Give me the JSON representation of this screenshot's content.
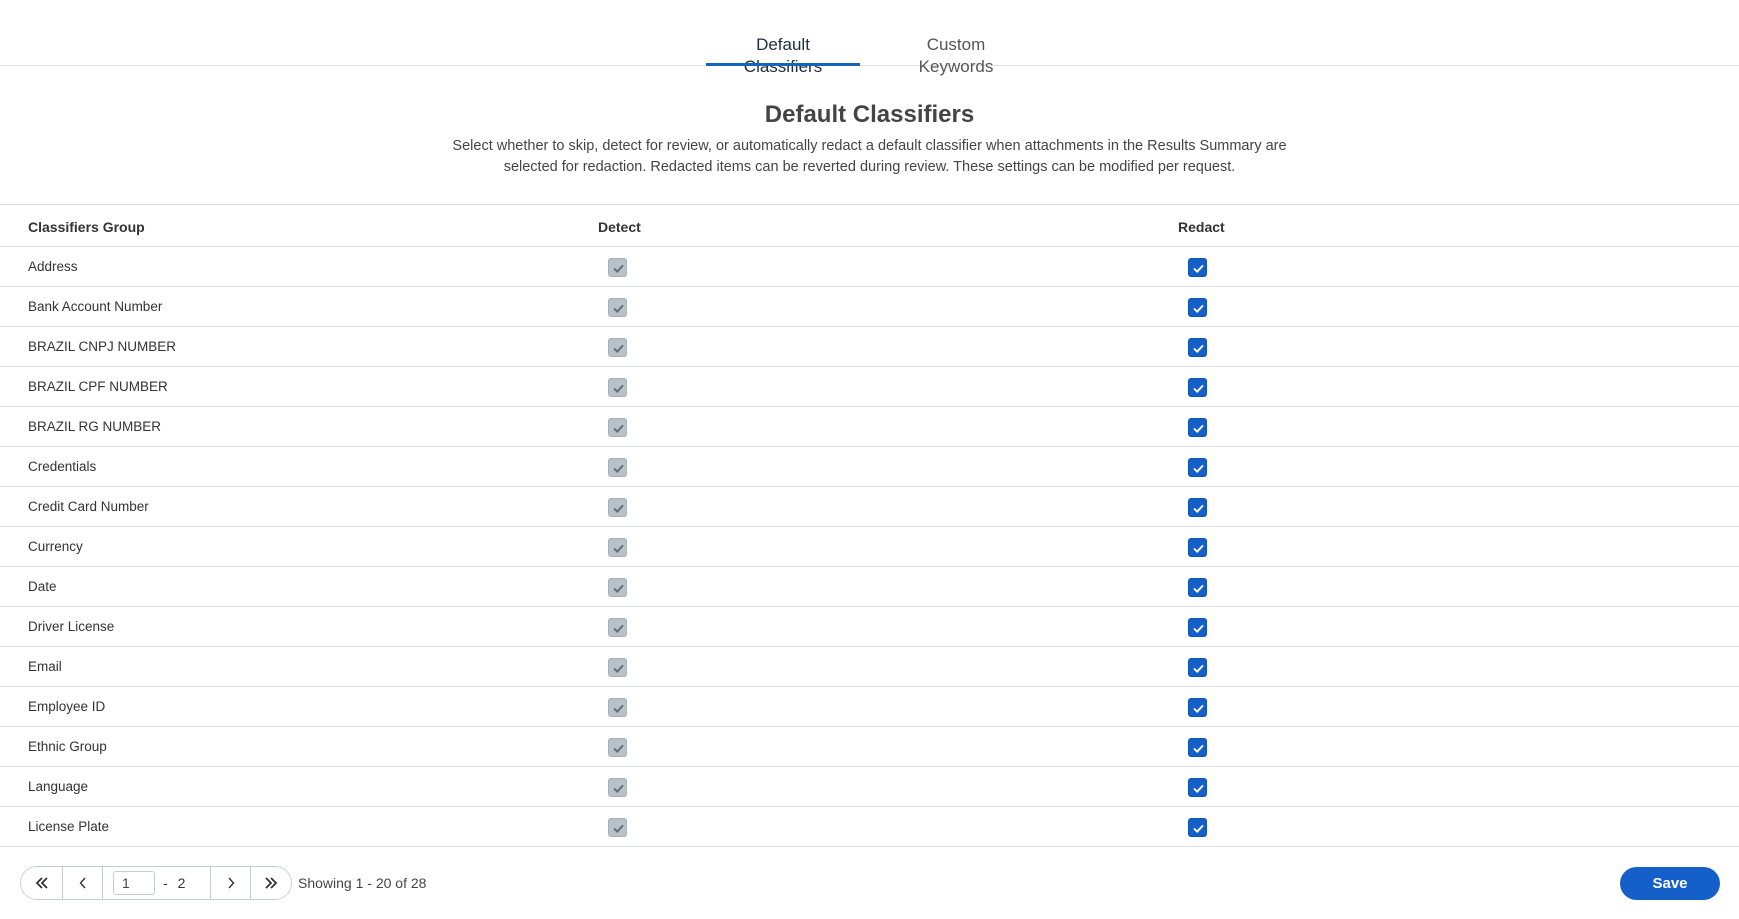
{
  "tabs": [
    {
      "label": "Default Classifiers",
      "active": true
    },
    {
      "label": "Custom Keywords",
      "active": false
    }
  ],
  "header": {
    "title": "Default Classifiers",
    "description": "Select whether to skip, detect for review, or automatically redact a default classifier when attachments in the Results Summary are selected for redaction. Redacted items can be reverted during review. These settings can be modified per request."
  },
  "table": {
    "columns": [
      "Classifiers Group",
      "Detect",
      "Redact"
    ],
    "rows": [
      {
        "name": "Address",
        "detect": true,
        "redact": true
      },
      {
        "name": "Bank Account Number",
        "detect": true,
        "redact": true
      },
      {
        "name": "BRAZIL CNPJ NUMBER",
        "detect": true,
        "redact": true
      },
      {
        "name": "BRAZIL CPF NUMBER",
        "detect": true,
        "redact": true
      },
      {
        "name": "BRAZIL RG NUMBER",
        "detect": true,
        "redact": true
      },
      {
        "name": "Credentials",
        "detect": true,
        "redact": true
      },
      {
        "name": "Credit Card Number",
        "detect": true,
        "redact": true
      },
      {
        "name": "Currency",
        "detect": true,
        "redact": true
      },
      {
        "name": "Date",
        "detect": true,
        "redact": true
      },
      {
        "name": "Driver License",
        "detect": true,
        "redact": true
      },
      {
        "name": "Email",
        "detect": true,
        "redact": true
      },
      {
        "name": "Employee ID",
        "detect": true,
        "redact": true
      },
      {
        "name": "Ethnic Group",
        "detect": true,
        "redact": true
      },
      {
        "name": "Language",
        "detect": true,
        "redact": true
      },
      {
        "name": "License Plate",
        "detect": true,
        "redact": true
      }
    ]
  },
  "pagination": {
    "current_page": "1",
    "separator": "-",
    "total_pages": "2",
    "showing_text": "Showing 1 - 20 of 28",
    "icons": [
      "double-chevron-left-icon",
      "chevron-left-icon",
      "chevron-right-icon",
      "double-chevron-right-icon"
    ]
  },
  "actions": {
    "save_label": "Save"
  },
  "colors": {
    "accent": "#1560c8",
    "disabled_checkbox": "#b8c0c8",
    "divider": "#d8dde2"
  }
}
